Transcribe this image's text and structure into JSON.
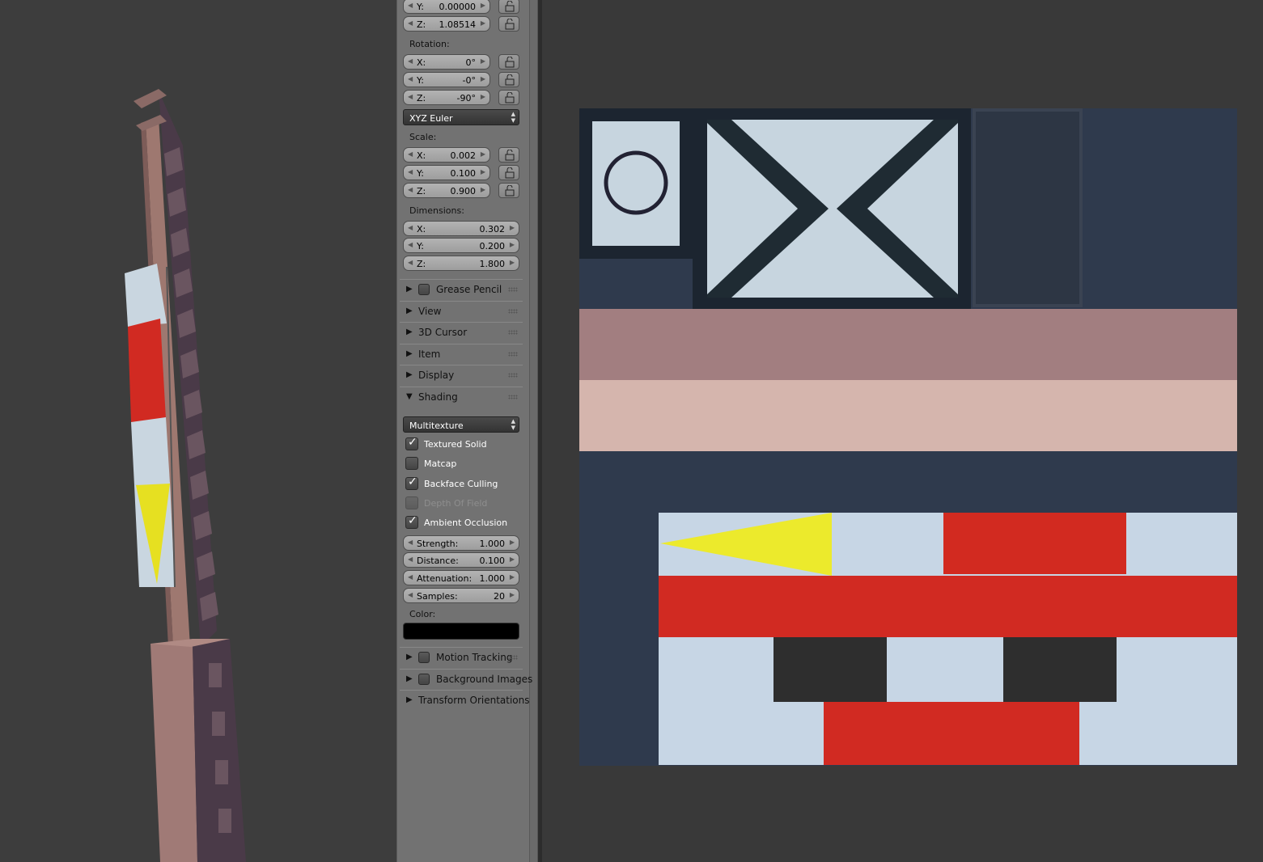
{
  "transform": {
    "location": [
      {
        "axis": "Y:",
        "value": "0.00000"
      },
      {
        "axis": "Z:",
        "value": "1.08514"
      }
    ],
    "rotation_label": "Rotation:",
    "rotation": [
      {
        "axis": "X:",
        "value": "0°"
      },
      {
        "axis": "Y:",
        "value": "-0°"
      },
      {
        "axis": "Z:",
        "value": "-90°"
      }
    ],
    "rotation_mode": "XYZ Euler",
    "scale_label": "Scale:",
    "scale": [
      {
        "axis": "X:",
        "value": "0.002"
      },
      {
        "axis": "Y:",
        "value": "0.100"
      },
      {
        "axis": "Z:",
        "value": "0.900"
      }
    ],
    "dimensions_label": "Dimensions:",
    "dimensions": [
      {
        "axis": "X:",
        "value": "0.302"
      },
      {
        "axis": "Y:",
        "value": "0.200"
      },
      {
        "axis": "Z:",
        "value": "1.800"
      }
    ]
  },
  "panels": {
    "grease_pencil": "Grease Pencil",
    "view": "View",
    "cursor3d": "3D Cursor",
    "item": "Item",
    "display": "Display",
    "shading": "Shading",
    "motion_tracking": "Motion Tracking",
    "background_images": "Background Images",
    "transform_orientations": "Transform Orientations"
  },
  "shading": {
    "mode": "Multitexture",
    "textured_solid": "Textured Solid",
    "matcap": "Matcap",
    "backface_culling": "Backface Culling",
    "depth_of_field": "Depth Of Field",
    "ambient_occlusion": "Ambient Occlusion",
    "ao": [
      {
        "label": "Strength:",
        "value": "1.000"
      },
      {
        "label": "Distance:",
        "value": "0.100"
      },
      {
        "label": "Attenuation:",
        "value": "1.000"
      },
      {
        "label": "Samples:",
        "value": "20"
      }
    ],
    "color_label": "Color:"
  }
}
